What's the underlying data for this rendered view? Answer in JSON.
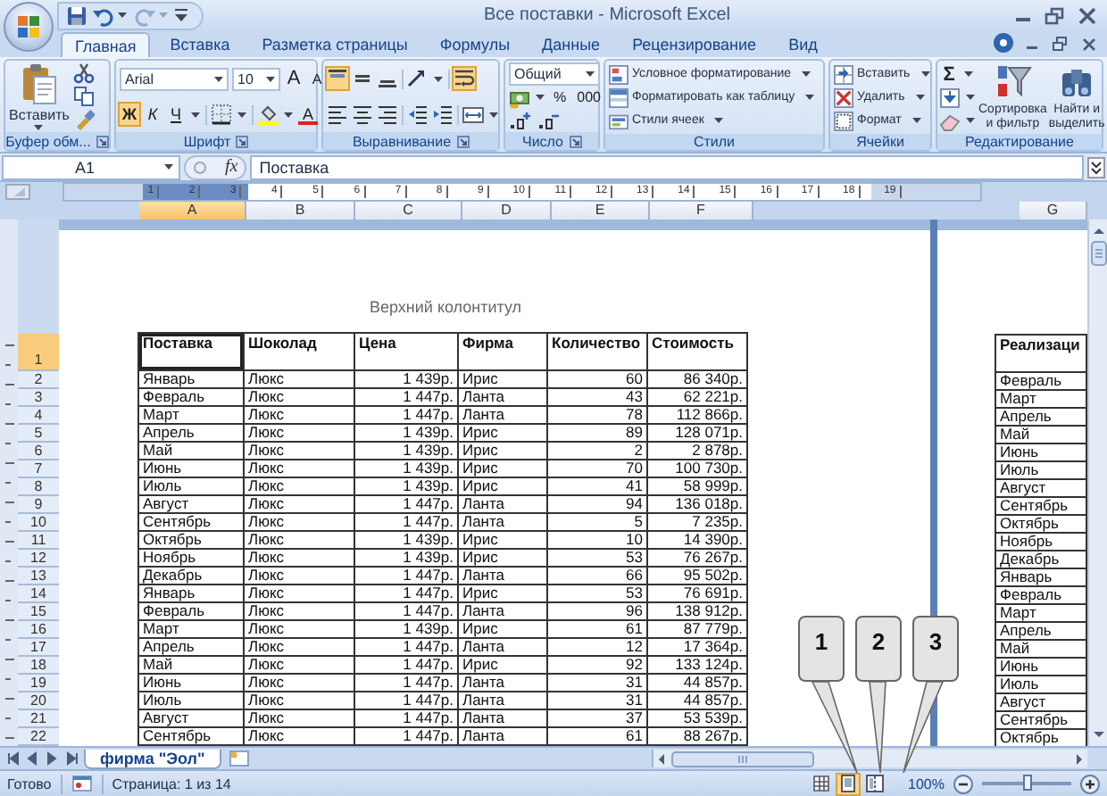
{
  "title_bar": {
    "quick_access": [
      {
        "kind": "save",
        "disabled": false
      },
      {
        "kind": "undo",
        "disabled": false
      },
      {
        "kind": "redo",
        "disabled": true
      }
    ],
    "title": "Все поставки - Microsoft Excel"
  },
  "ribbon_tabs": [
    {
      "label": "Главная",
      "selected": true
    },
    {
      "label": "Вставка",
      "selected": false
    },
    {
      "label": "Разметка страницы",
      "selected": false
    },
    {
      "label": "Формулы",
      "selected": false
    },
    {
      "label": "Данные",
      "selected": false
    },
    {
      "label": "Рецензирование",
      "selected": false
    },
    {
      "label": "Вид",
      "selected": false
    }
  ],
  "ribbon": {
    "clipboard": {
      "label": "Буфер обм...",
      "paste": "Вставить"
    },
    "font": {
      "label": "Шрифт",
      "font_name": "Arial",
      "font_size": "10",
      "grow": "A",
      "shrink": "A",
      "font_color": "A",
      "styles": [
        {
          "kind": "bold",
          "text": "Ж",
          "on": true
        },
        {
          "kind": "italic",
          "text": "К",
          "on": false
        },
        {
          "kind": "underline",
          "text": "Ч",
          "on": false
        }
      ]
    },
    "alignment": {
      "label": "Выравнивание",
      "buttons": [
        {
          "kind": "top",
          "on": true
        },
        {
          "kind": "middle",
          "on": false
        },
        {
          "kind": "bottom",
          "on": false
        },
        {
          "kind": "orientation",
          "on": false
        },
        {
          "kind": "wrap",
          "on": true
        },
        {
          "kind": "left",
          "on": false
        },
        {
          "kind": "center",
          "on": false
        },
        {
          "kind": "right",
          "on": false
        },
        {
          "kind": "outdent",
          "on": false
        },
        {
          "kind": "indent",
          "on": false
        },
        {
          "kind": "merge",
          "on": false
        }
      ]
    },
    "number": {
      "label": "Число",
      "format": "Общий",
      "percent": "%",
      "thousands": "000"
    },
    "styles": {
      "label": "Стили",
      "items": [
        {
          "kind": "conditional",
          "text": "Условное форматирование"
        },
        {
          "kind": "table",
          "text": "Форматировать как таблицу"
        },
        {
          "kind": "cell_styles",
          "text": "Стили ячеек"
        }
      ]
    },
    "cells": {
      "label": "Ячейки",
      "items": [
        {
          "kind": "insert",
          "text": "Вставить"
        },
        {
          "kind": "delete",
          "text": "Удалить"
        },
        {
          "kind": "format",
          "text": "Формат"
        }
      ]
    },
    "editing": {
      "label": "Редактирование",
      "sum": "Σ",
      "sort": "Сортировка и фильтр",
      "find": "Найти и выделить"
    }
  },
  "formula_bar": {
    "name_box": "A1",
    "function_label": "fx",
    "value": "Поставка"
  },
  "ruler": [
    "1",
    "2",
    "3",
    "4",
    "5",
    "6",
    "7",
    "8",
    "9",
    "10",
    "11",
    "12",
    "13",
    "14",
    "15",
    "16",
    "17",
    "18",
    "19"
  ],
  "column_headers": [
    {
      "label": "A",
      "selected": true
    },
    {
      "label": "B",
      "selected": false
    },
    {
      "label": "C",
      "selected": false
    },
    {
      "label": "D",
      "selected": false
    },
    {
      "label": "E",
      "selected": false
    },
    {
      "label": "F",
      "selected": false
    }
  ],
  "row_headers": [
    {
      "label": "1",
      "selected": true
    },
    {
      "label": "2",
      "selected": false
    },
    {
      "label": "3",
      "selected": false
    },
    {
      "label": "4",
      "selected": false
    },
    {
      "label": "5",
      "selected": false
    },
    {
      "label": "6",
      "selected": false
    },
    {
      "label": "7",
      "selected": false
    },
    {
      "label": "8",
      "selected": false
    },
    {
      "label": "9",
      "selected": false
    },
    {
      "label": "10",
      "selected": false
    },
    {
      "label": "11",
      "selected": false
    },
    {
      "label": "12",
      "selected": false
    },
    {
      "label": "13",
      "selected": false
    },
    {
      "label": "14",
      "selected": false
    },
    {
      "label": "15",
      "selected": false
    },
    {
      "label": "16",
      "selected": false
    },
    {
      "label": "17",
      "selected": false
    },
    {
      "label": "18",
      "selected": false
    },
    {
      "label": "19",
      "selected": false
    },
    {
      "label": "20",
      "selected": false
    },
    {
      "label": "21",
      "selected": false
    },
    {
      "label": "22",
      "selected": false
    }
  ],
  "page": {
    "header": "Верхний колонтитул",
    "table": {
      "headers": [
        {
          "text": "Поставка",
          "selected": true
        },
        {
          "text": "Шоколад",
          "selected": false
        },
        {
          "text": "Цена",
          "selected": false
        },
        {
          "text": "Фирма",
          "selected": false
        },
        {
          "text": "Количество",
          "selected": false
        },
        {
          "text": "Стоимость",
          "selected": false
        }
      ],
      "rows": [
        [
          "Январь",
          "Люкс",
          "1 439р.",
          "Ирис",
          "60",
          "86 340р."
        ],
        [
          "Февраль",
          "Люкс",
          "1 447р.",
          "Ланта",
          "43",
          "62 221р."
        ],
        [
          "Март",
          "Люкс",
          "1 447р.",
          "Ланта",
          "78",
          "112 866р."
        ],
        [
          "Апрель",
          "Люкс",
          "1 439р.",
          "Ирис",
          "89",
          "128 071р."
        ],
        [
          "Май",
          "Люкс",
          "1 439р.",
          "Ирис",
          "2",
          "2 878р."
        ],
        [
          "Июнь",
          "Люкс",
          "1 439р.",
          "Ирис",
          "70",
          "100 730р."
        ],
        [
          "Июль",
          "Люкс",
          "1 439р.",
          "Ирис",
          "41",
          "58 999р."
        ],
        [
          "Август",
          "Люкс",
          "1 447р.",
          "Ланта",
          "94",
          "136 018р."
        ],
        [
          "Сентябрь",
          "Люкс",
          "1 447р.",
          "Ланта",
          "5",
          "7 235р."
        ],
        [
          "Октябрь",
          "Люкс",
          "1 439р.",
          "Ирис",
          "10",
          "14 390р."
        ],
        [
          "Ноябрь",
          "Люкс",
          "1 439р.",
          "Ирис",
          "53",
          "76 267р."
        ],
        [
          "Декабрь",
          "Люкс",
          "1 447р.",
          "Ланта",
          "66",
          "95 502р."
        ],
        [
          "Январь",
          "Люкс",
          "1 447р.",
          "Ирис",
          "53",
          "76 691р."
        ],
        [
          "Февраль",
          "Люкс",
          "1 447р.",
          "Ланта",
          "96",
          "138 912р."
        ],
        [
          "Март",
          "Люкс",
          "1 439р.",
          "Ирис",
          "61",
          "87 779р."
        ],
        [
          "Апрель",
          "Люкс",
          "1 447р.",
          "Ланта",
          "12",
          "17 364р."
        ],
        [
          "Май",
          "Люкс",
          "1 447р.",
          "Ирис",
          "92",
          "133 124р."
        ],
        [
          "Июнь",
          "Люкс",
          "1 447р.",
          "Ланта",
          "31",
          "44 857р."
        ],
        [
          "Июль",
          "Люкс",
          "1 447р.",
          "Ланта",
          "31",
          "44 857р."
        ],
        [
          "Август",
          "Люкс",
          "1 447р.",
          "Ланта",
          "37",
          "53 539р."
        ],
        [
          "Сентябрь",
          "Люкс",
          "1 447р.",
          "Ланта",
          "61",
          "88 267р."
        ]
      ]
    }
  },
  "next_page": {
    "column_header": {
      "label": "G",
      "selected": false
    },
    "header": "Реализаци",
    "rows": [
      "Февраль",
      "Март",
      "Апрель",
      "Май",
      "Июнь",
      "Июль",
      "Август",
      "Сентябрь",
      "Октябрь",
      "Ноябрь",
      "Декабрь",
      "Январь",
      "Февраль",
      "Март",
      "Апрель",
      "Май",
      "Июнь",
      "Июль",
      "Август",
      "Сентябрь",
      "Октябрь"
    ]
  },
  "sheet_tabs": [
    {
      "label": "фирма \"Эол\"",
      "selected": true
    }
  ],
  "status_bar": {
    "status": "Готово",
    "page": "Страница: 1 из 14",
    "views": [
      {
        "kind": "normal",
        "selected": false
      },
      {
        "kind": "page_layout",
        "selected": true
      },
      {
        "kind": "page_break",
        "selected": false
      }
    ],
    "zoom": "100%",
    "zoom_slider": {
      "level": 0.5
    }
  },
  "callouts": [
    "1",
    "2",
    "3"
  ]
}
